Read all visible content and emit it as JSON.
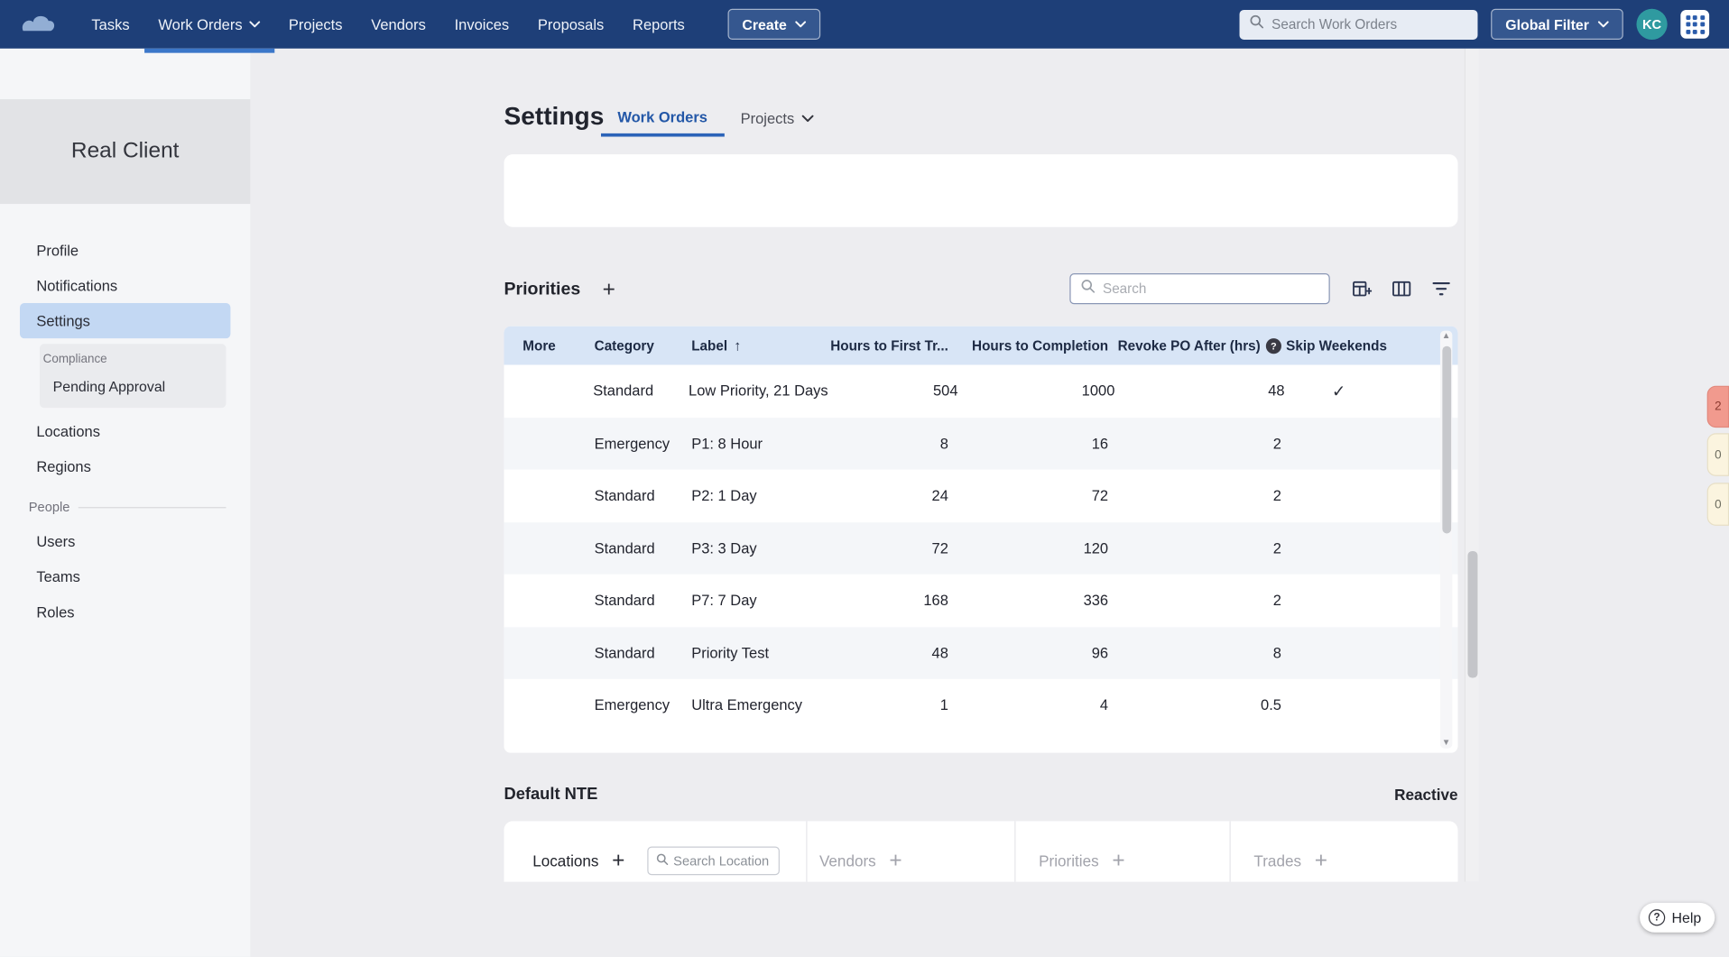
{
  "colors": {
    "navbar_bg": "#1e3f78",
    "accent_blue": "#2b63b8",
    "nav_underline": "#3b77c9",
    "selected_item_bg": "#c3d8f3",
    "table_header_bg": "#d8e5f6",
    "avatar_bg": "#2f9aa0",
    "edge_tab_red": "#f19a8e",
    "edge_tab_cream": "#fbf4df"
  },
  "navbar": {
    "items": [
      {
        "label": "Tasks",
        "caret": false
      },
      {
        "label": "Work Orders",
        "caret": true
      },
      {
        "label": "Projects",
        "caret": false
      },
      {
        "label": "Vendors",
        "caret": false
      },
      {
        "label": "Invoices",
        "caret": false
      },
      {
        "label": "Proposals",
        "caret": false
      },
      {
        "label": "Reports",
        "caret": false
      }
    ],
    "active": "Work Orders",
    "create_label": "Create",
    "search_placeholder": "Search Work Orders",
    "global_filter_label": "Global Filter",
    "avatar_initials": "KC"
  },
  "sidebar": {
    "client_name": "Real Client",
    "items_top": [
      "Profile",
      "Notifications",
      "Settings"
    ],
    "active_item": "Settings",
    "compliance_label": "Compliance",
    "compliance_item": "Pending Approval",
    "items_mid": [
      "Locations",
      "Regions"
    ],
    "people_label": "People",
    "items_people": [
      "Users",
      "Teams",
      "Roles"
    ]
  },
  "page": {
    "title": "Settings",
    "tab_active": "Work Orders",
    "tab_inactive": "Projects"
  },
  "priorities": {
    "title": "Priorities",
    "search_placeholder": "Search",
    "headers": {
      "more": "More",
      "category": "Category",
      "label": "Label",
      "hours_first": "Hours to First Tr...",
      "hours_completion": "Hours to Completion",
      "revoke_po": "Revoke PO After (hrs)",
      "skip_weekends": "Skip Weekends"
    },
    "rows": [
      {
        "category": "Standard",
        "label": "Low Priority, 21 Days",
        "hours_first": "504",
        "hours_completion": "1000",
        "revoke_po": "48",
        "skip_weekends": true
      },
      {
        "category": "Emergency",
        "label": "P1: 8 Hour",
        "hours_first": "8",
        "hours_completion": "16",
        "revoke_po": "2",
        "skip_weekends": false
      },
      {
        "category": "Standard",
        "label": "P2: 1 Day",
        "hours_first": "24",
        "hours_completion": "72",
        "revoke_po": "2",
        "skip_weekends": false
      },
      {
        "category": "Standard",
        "label": "P3: 3 Day",
        "hours_first": "72",
        "hours_completion": "120",
        "revoke_po": "2",
        "skip_weekends": false
      },
      {
        "category": "Standard",
        "label": "P7: 7 Day",
        "hours_first": "168",
        "hours_completion": "336",
        "revoke_po": "2",
        "skip_weekends": false
      },
      {
        "category": "Standard",
        "label": "Priority Test",
        "hours_first": "48",
        "hours_completion": "96",
        "revoke_po": "8",
        "skip_weekends": false
      },
      {
        "category": "Emergency",
        "label": "Ultra Emergency",
        "hours_first": "1",
        "hours_completion": "4",
        "revoke_po": "0.5",
        "skip_weekends": false
      }
    ]
  },
  "default_nte": {
    "title": "Default NTE",
    "mode": "Reactive",
    "locations_label": "Locations",
    "location_search_placeholder": "Search Location",
    "vendors_label": "Vendors",
    "priorities_label": "Priorities",
    "trades_label": "Trades"
  },
  "edge_tabs": [
    {
      "text": "2"
    },
    {
      "text": "0"
    },
    {
      "text": "0"
    }
  ],
  "help_label": "Help"
}
